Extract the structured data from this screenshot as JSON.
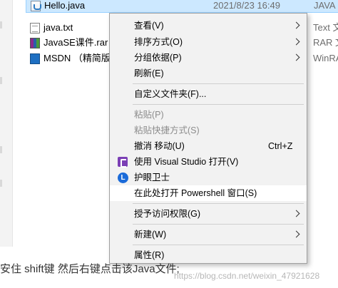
{
  "files": [
    {
      "name": "Hello.java",
      "date": "2021/8/23 16:49",
      "type": "JAVA",
      "icon": "java-file-icon",
      "selected": true
    },
    {
      "name": "java.txt",
      "date": "",
      "type": "Text 文",
      "icon": "text-file-icon",
      "selected": false
    },
    {
      "name": "JavaSE课件.rar",
      "date": "",
      "type": "RAR 文",
      "icon": "rar-file-icon",
      "selected": false
    },
    {
      "name": "MSDN （精简版）",
      "date": "",
      "type": "WinRA",
      "icon": "msdn-file-icon",
      "selected": false
    }
  ],
  "menu": {
    "view": "查看(V)",
    "sort_by": "排序方式(O)",
    "group_by": "分组依据(P)",
    "refresh": "刷新(E)",
    "customize_folder": "自定义文件夹(F)...",
    "paste": "粘贴(P)",
    "paste_shortcut": "粘贴快捷方式(S)",
    "undo_move": "撤消 移动(U)",
    "undo_shortcut": "Ctrl+Z",
    "open_with_vs": "使用 Visual Studio 打开(V)",
    "guard": "护眼卫士",
    "open_powershell": "在此处打开 Powershell 窗口(S)",
    "give_access": "授予访问权限(G)",
    "new": "新建(W)",
    "properties": "属性(R)"
  },
  "caption": "安住 shift键 然后右键点击该Java文件;",
  "watermark": "https://blog.csdn.net/weixin_47921628"
}
